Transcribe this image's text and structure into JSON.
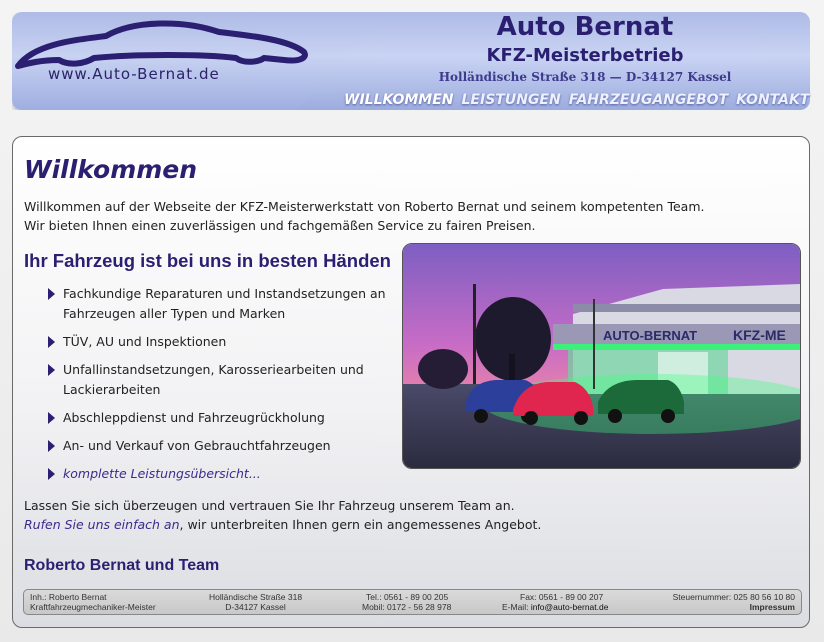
{
  "header": {
    "url": "www.Auto-Bernat.de",
    "brand_title": "Auto Bernat",
    "brand_sub": "KFZ-Meisterbetrieb",
    "address": "Holländische Straße 318 — D-34127 Kassel"
  },
  "nav": {
    "items": [
      {
        "label": "WILLKOMMEN"
      },
      {
        "label": "LEISTUNGEN"
      },
      {
        "label": "FAHRZEUGANGEBOT"
      },
      {
        "label": "KONTAKT"
      }
    ]
  },
  "main": {
    "title": "Willkommen",
    "intro_line1": "Willkommen auf der Webseite der KFZ-Meisterwerkstatt von Roberto Bernat und seinem kompetenten Team.",
    "intro_line2": "Wir bieten Ihnen einen zuverlässigen und fachgemäßen Service zu fairen Preisen.",
    "section_title": "Ihr Fahrzeug ist bei uns in besten Händen",
    "services": [
      "Fachkundige Reparaturen und Instandsetzungen an Fahrzeugen aller Typen und Marken",
      "TÜV, AU und Inspektionen",
      "Unfallinstandsetzungen, Karosseriearbeiten und Lackierarbeiten",
      "Abschleppdienst und Fahrzeugrückholung",
      "An- und Verkauf von Gebrauchtfahrzeugen"
    ],
    "services_link": "komplette Leistungsübersicht...",
    "photo_sign_left": "AUTO-BERNAT",
    "photo_sign_right": "KFZ-ME",
    "closing_line1": "Lassen Sie sich überzeugen und vertrauen Sie Ihr Fahrzeug unserem Team an.",
    "closing_cta": "Rufen Sie uns einfach an",
    "closing_rest": ", wir unterbreiten Ihnen gern ein angemessenes Angebot.",
    "signature": "Roberto Bernat und Team"
  },
  "footer": {
    "owner": "Inh.: Roberto Bernat",
    "owner_title": "Kraftfahrzeugmechaniker-Meister",
    "street": "Holländische Straße 318",
    "city": "D-34127 Kassel",
    "tel": "Tel.: 0561 - 89 00 205",
    "mobil": "Mobil: 0172 - 56 28 978",
    "fax": "Fax: 0561 - 89 00 207",
    "email_label": "E-Mail:",
    "email": "info@auto-bernat.de",
    "tax": "Steuernummer: 025 80 56 10 80",
    "impressum": "Impressum"
  },
  "colors": {
    "accent": "#2b1f72",
    "link": "#3d2a8e",
    "header": "#aebbe6"
  }
}
